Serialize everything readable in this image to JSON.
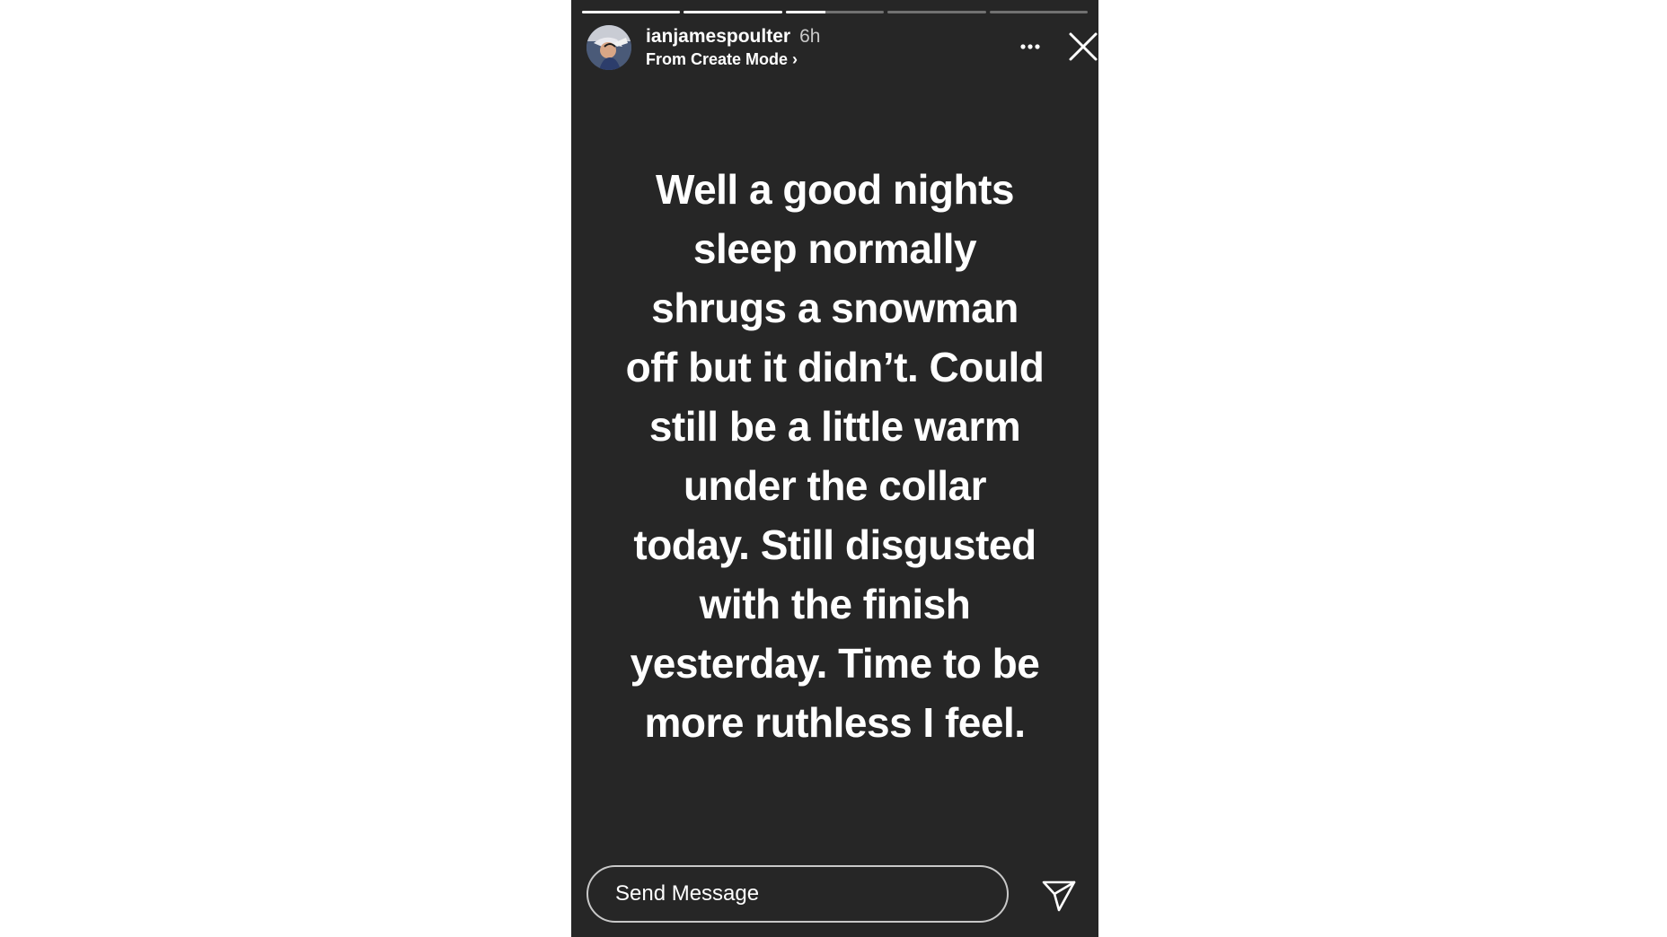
{
  "story": {
    "progress": [
      {
        "fraction": 1.0
      },
      {
        "fraction": 1.0
      },
      {
        "fraction": 0.4
      },
      {
        "fraction": 0.0
      },
      {
        "fraction": 0.0
      }
    ],
    "username": "ianjamespoulter",
    "time_ago": "6h",
    "subline": "From Create Mode",
    "subline_chevron": "›",
    "caption_lines": [
      "Well a good nights",
      "sleep normally",
      "shrugs a snowman",
      "off but it didn’t. Could",
      "still be a little warm",
      "under the collar",
      "today. Still disgusted",
      "with the finish",
      "yesterday. Time to be",
      "more ruthless I feel."
    ],
    "icons": {
      "avatar": "profile-photo",
      "more": "more-dots-icon",
      "close": "close-icon",
      "send": "paper-plane-icon"
    }
  },
  "reply": {
    "placeholder": "Send Message"
  },
  "colors": {
    "story_background": "#262626",
    "page_background": "#ffffff",
    "text": "#ffffff"
  }
}
